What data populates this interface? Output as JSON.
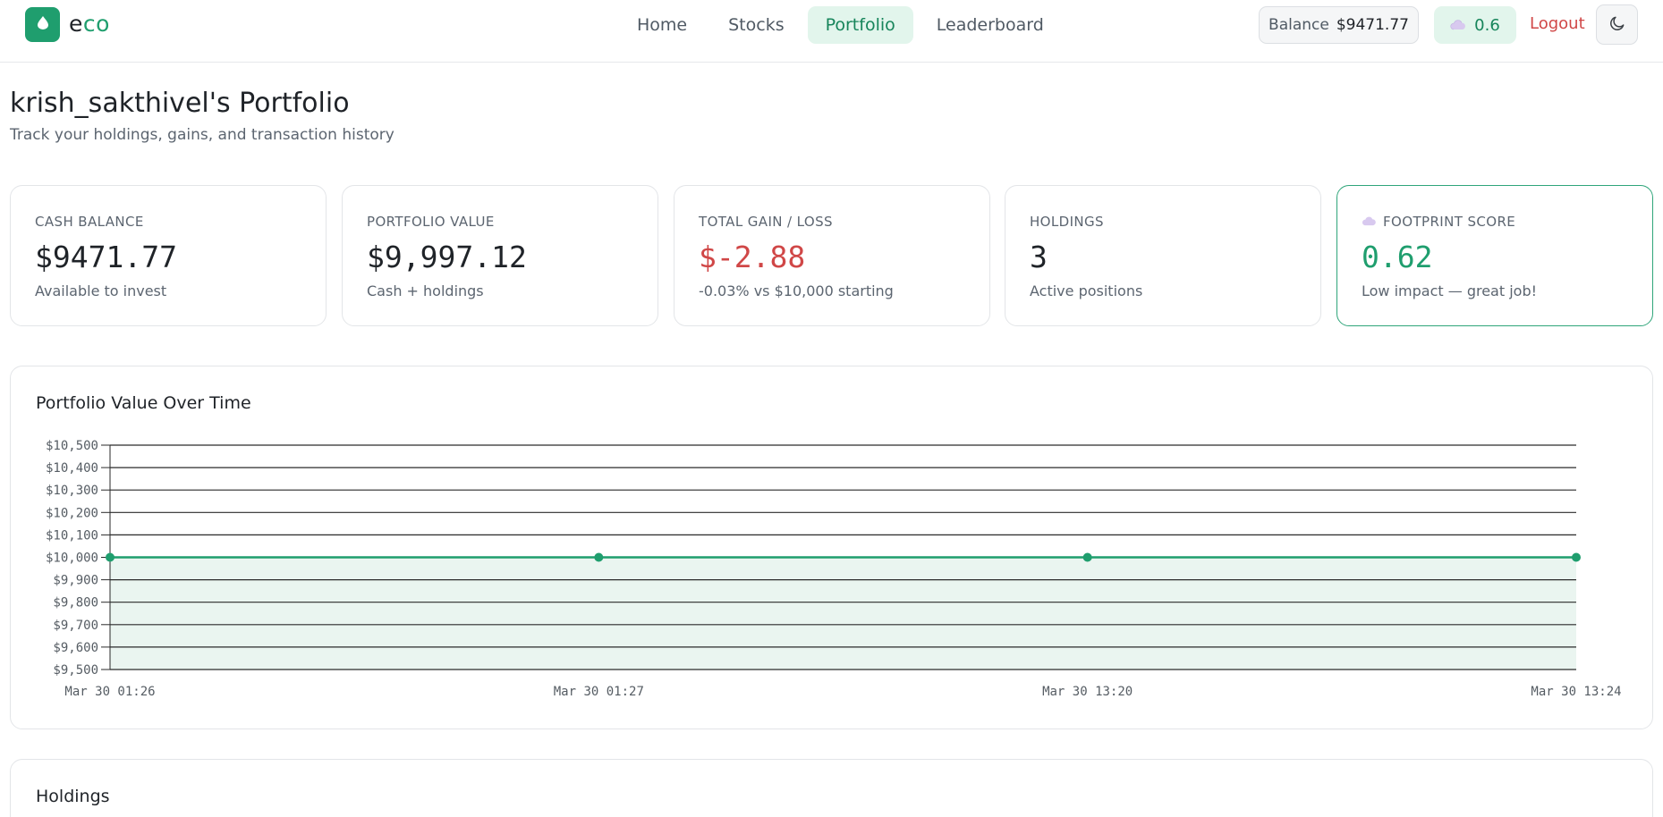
{
  "app": {
    "logo_letter": "e",
    "logo_rest": "co",
    "brand_color": "#1f9e6e",
    "logo_icon": "leaf-drop-icon"
  },
  "nav": {
    "items": [
      {
        "label": "Home",
        "active": false
      },
      {
        "label": "Stocks",
        "active": false
      },
      {
        "label": "Portfolio",
        "active": true
      },
      {
        "label": "Leaderboard",
        "active": false
      }
    ]
  },
  "header_right": {
    "balance_label": "Balance",
    "balance_value": "$9471.77",
    "score_icon": "cloud-icon",
    "score_value": "0.6",
    "logout_label": "Logout",
    "theme_icon": "moon-icon"
  },
  "page": {
    "title": "krish_sakthivel's Portfolio",
    "subtitle": "Track your holdings, gains, and transaction history"
  },
  "cards": [
    {
      "label": "CASH BALANCE",
      "value": "$9471.77",
      "note": "Available to invest",
      "tone": "default"
    },
    {
      "label": "PORTFOLIO VALUE",
      "value": "$9,997.12",
      "note": "Cash + holdings",
      "tone": "default"
    },
    {
      "label": "TOTAL GAIN / LOSS",
      "value": "$-2.88",
      "note": "-0.03% vs $10,000 starting",
      "tone": "negative"
    },
    {
      "label": "HOLDINGS",
      "value": "3",
      "note": "Active positions",
      "tone": "default"
    },
    {
      "label": "FOOTPRINT SCORE",
      "value": "0.62",
      "note": "Low impact — great job!",
      "tone": "positive",
      "icon": "cloud-icon"
    }
  ],
  "chart_section": {
    "title": "Portfolio Value Over Time"
  },
  "chart_data": {
    "type": "area",
    "title": "Portfolio Value Over Time",
    "xlabel": "",
    "ylabel": "",
    "categories": [
      "Mar 30 01:26",
      "Mar 30 01:27",
      "Mar 30 13:20",
      "Mar 30 13:24"
    ],
    "series": [
      {
        "values": [
          10000,
          10000,
          10000,
          10000
        ],
        "color": "#1f9e6e"
      }
    ],
    "ylim": [
      9500,
      10500
    ],
    "yticks": [
      10500,
      10400,
      10300,
      10200,
      10100,
      10000,
      9900,
      9800,
      9700,
      9600,
      9500
    ],
    "ytick_labels": [
      "$10,500",
      "$10,400",
      "$10,300",
      "$10,200",
      "$10,100",
      "$10,000",
      "$9,900",
      "$9,800",
      "$9,700",
      "$9,600",
      "$9,500"
    ],
    "grid": true,
    "area_fill": "#eaf5f0"
  },
  "holdings_section": {
    "title": "Holdings"
  }
}
